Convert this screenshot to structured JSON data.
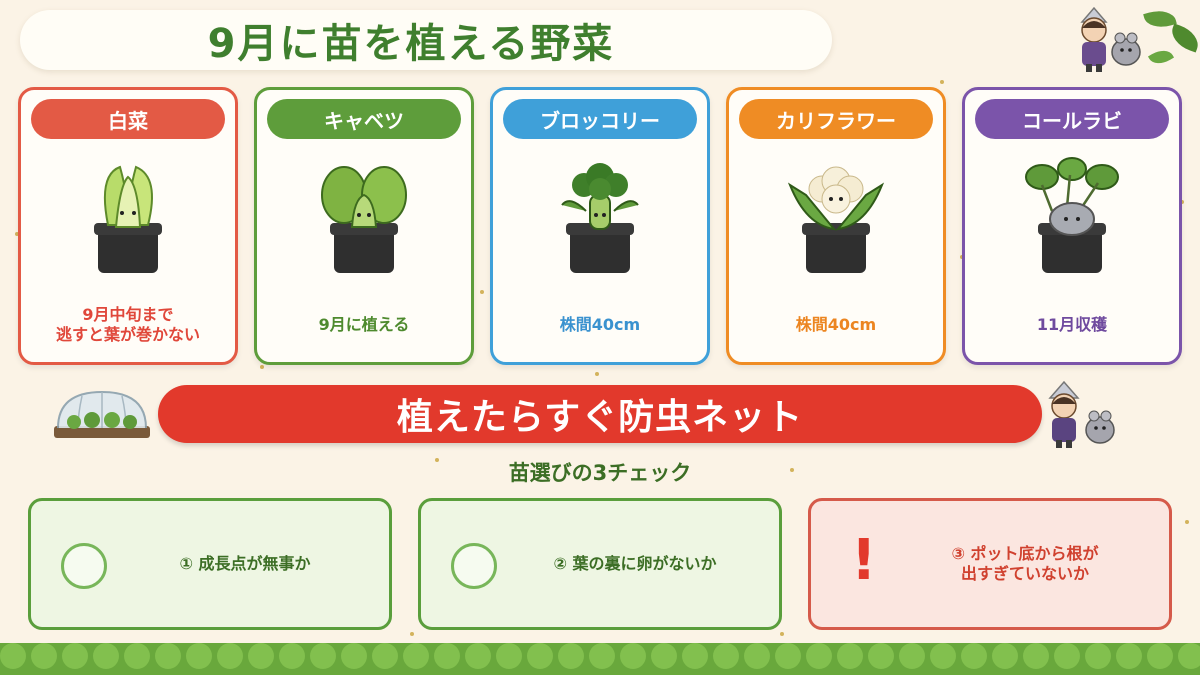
{
  "title": "9月に苗を植える野菜",
  "vegetables": [
    {
      "name": "白菜",
      "note_lines": [
        "9月中旬まで",
        "逃すと葉が巻かない"
      ],
      "color": "#e35a45",
      "icon": "napa-cabbage-icon"
    },
    {
      "name": "キャベツ",
      "note_lines": [
        "9月に植える"
      ],
      "color": "#5e9d3b",
      "icon": "cabbage-icon"
    },
    {
      "name": "ブロッコリー",
      "note_lines": [
        "株間40cm"
      ],
      "color": "#3fa0d9",
      "icon": "broccoli-icon"
    },
    {
      "name": "カリフラワー",
      "note_lines": [
        "株間40cm"
      ],
      "color": "#ef8c24",
      "icon": "cauliflower-icon"
    },
    {
      "name": "コールラビ",
      "note_lines": [
        "11月収穫"
      ],
      "color": "#7b54aa",
      "icon": "kohlrabi-icon"
    }
  ],
  "banner": "植えたらすぐ防虫ネット",
  "subheading": "苗選びの3チェック",
  "checks": [
    {
      "lines": [
        "① 成長点が無事か"
      ],
      "type": "ok",
      "icon": "circle-mark-icon"
    },
    {
      "lines": [
        "② 葉の裏に卵がないか"
      ],
      "type": "ok",
      "icon": "circle-mark-icon"
    },
    {
      "lines": [
        "③ ポット底から根が",
        "出すぎていないか"
      ],
      "type": "warn",
      "icon": "exclamation-icon"
    }
  ],
  "colors": {
    "title": "#3f7f2e",
    "banner": "#e2392c",
    "check_ok": "#5a9e3c",
    "check_warn": "#d55a4a",
    "background": "#fbf3e6"
  }
}
